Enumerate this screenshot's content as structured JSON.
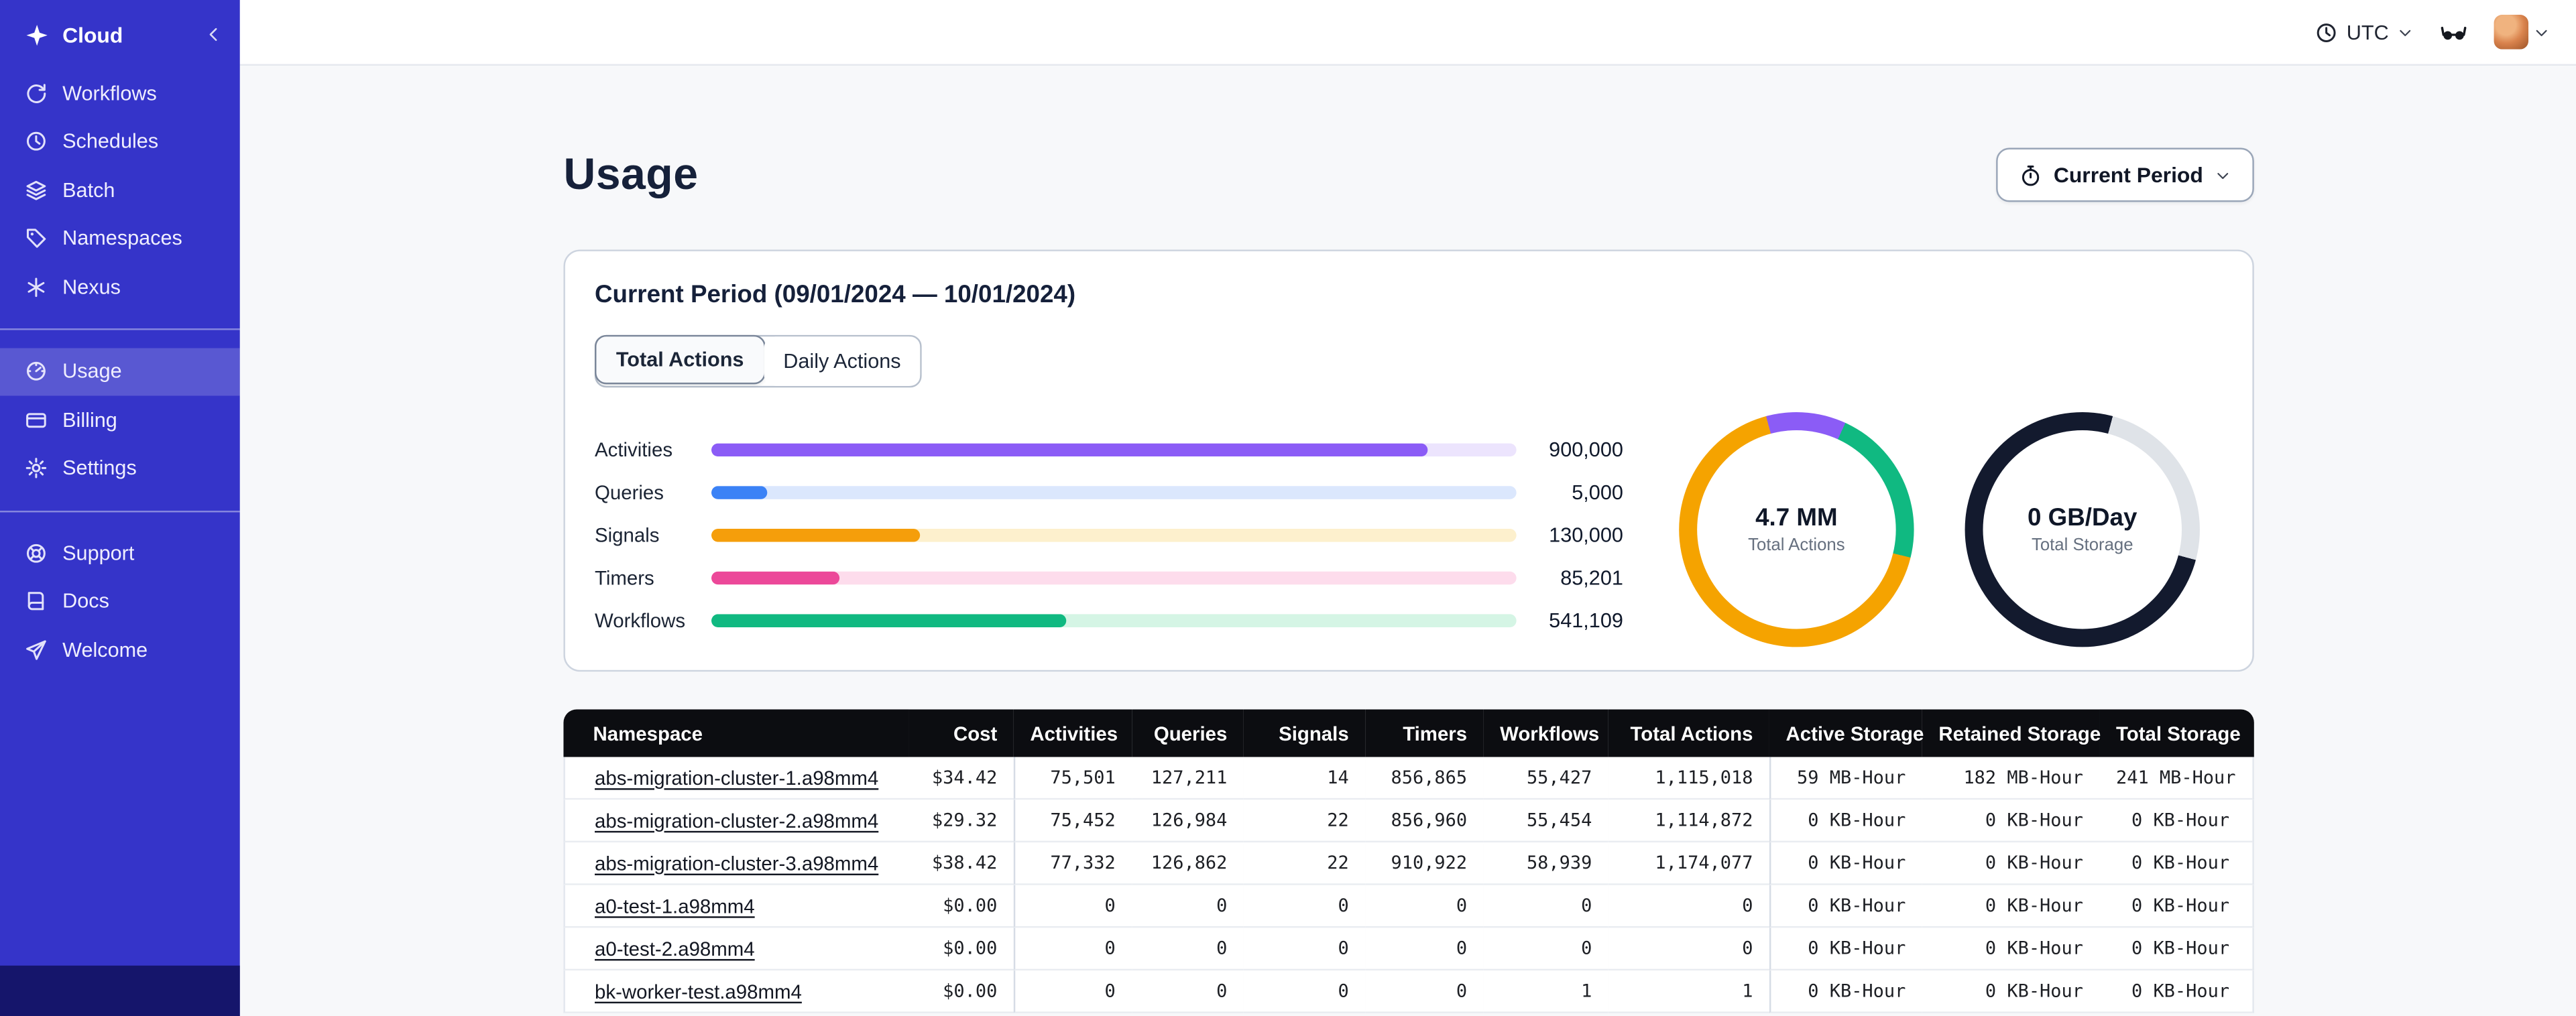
{
  "sidebar": {
    "brand_label": "Cloud",
    "nav_main": [
      {
        "label": "Workflows",
        "icon": "workflows-icon"
      },
      {
        "label": "Schedules",
        "icon": "schedules-icon"
      },
      {
        "label": "Batch",
        "icon": "batch-icon"
      },
      {
        "label": "Namespaces",
        "icon": "namespaces-icon"
      },
      {
        "label": "Nexus",
        "icon": "nexus-icon"
      }
    ],
    "nav_account": [
      {
        "label": "Usage",
        "icon": "usage-icon",
        "active": true
      },
      {
        "label": "Billing",
        "icon": "billing-icon"
      },
      {
        "label": "Settings",
        "icon": "settings-icon"
      }
    ],
    "nav_help": [
      {
        "label": "Support",
        "icon": "support-icon"
      },
      {
        "label": "Docs",
        "icon": "docs-icon"
      },
      {
        "label": "Welcome",
        "icon": "welcome-icon"
      }
    ],
    "colors": {
      "background": "#3534c9",
      "footer": "#15156b",
      "active_item": "rgba(255,255,255,0.18)"
    }
  },
  "topbar": {
    "timezone": "UTC"
  },
  "page": {
    "title": "Usage",
    "period_selector": {
      "label": "Current Period"
    },
    "card": {
      "title": "Current Period (09/01/2024 — 10/01/2024)",
      "tabs": [
        {
          "label": "Total Actions",
          "active": true
        },
        {
          "label": "Daily Actions",
          "active": false
        }
      ]
    }
  },
  "chart_data": [
    {
      "type": "bar",
      "orientation": "horizontal",
      "categories": [
        "Activities",
        "Queries",
        "Signals",
        "Timers",
        "Workflows"
      ],
      "values": [
        900000,
        5000,
        130000,
        85201,
        541109
      ],
      "value_labels": [
        "900,000",
        "5,000",
        "130,000",
        "85,201",
        "541,109"
      ],
      "bar_percents": [
        89,
        7,
        26,
        16,
        44
      ],
      "colors": [
        "#8b5cf6",
        "#3b82f6",
        "#f59e0b",
        "#ec4899",
        "#10b981"
      ],
      "track_colors": [
        "#ece4fd",
        "#dbe7fd",
        "#fdf0cd",
        "#fddcec",
        "#d5f5e5"
      ],
      "title": "",
      "xlabel": "",
      "ylabel": "",
      "grid": false,
      "legend": false
    },
    {
      "type": "pie",
      "style": "donut",
      "center_value": "4.7 MM",
      "center_label": "Total Actions",
      "start_angle": -15,
      "segments": [
        {
          "name": "purple-segment",
          "percent": 11,
          "color": "#8b5cf6"
        },
        {
          "name": "green-segment",
          "percent": 22,
          "color": "#10b981"
        },
        {
          "name": "orange-segment",
          "percent": 67,
          "color": "#f5a300"
        }
      ]
    },
    {
      "type": "pie",
      "style": "donut",
      "center_value": "0 GB/Day",
      "center_label": "Total Storage",
      "start_angle": 15,
      "segments": [
        {
          "name": "gray-segment",
          "percent": 25,
          "color": "#dfe3e8"
        },
        {
          "name": "dark-segment",
          "percent": 75,
          "color": "#131a2e"
        }
      ]
    }
  ],
  "table": {
    "columns": [
      "Namespace",
      "Cost",
      "Activities",
      "Queries",
      "Signals",
      "Timers",
      "Workflows",
      "Total Actions",
      "Active Storage",
      "Retained Storage",
      "Total Storage"
    ],
    "rows": [
      [
        "abs-migration-cluster-1.a98mm4",
        "$34.42",
        "75,501",
        "127,211",
        "14",
        "856,865",
        "55,427",
        "1,115,018",
        "59 MB-Hour",
        "182 MB-Hour",
        "241 MB-Hour"
      ],
      [
        "abs-migration-cluster-2.a98mm4",
        "$29.32",
        "75,452",
        "126,984",
        "22",
        "856,960",
        "55,454",
        "1,114,872",
        "0 KB-Hour",
        "0 KB-Hour",
        "0 KB-Hour"
      ],
      [
        "abs-migration-cluster-3.a98mm4",
        "$38.42",
        "77,332",
        "126,862",
        "22",
        "910,922",
        "58,939",
        "1,174,077",
        "0 KB-Hour",
        "0 KB-Hour",
        "0 KB-Hour"
      ],
      [
        "a0-test-1.a98mm4",
        "$0.00",
        "0",
        "0",
        "0",
        "0",
        "0",
        "0",
        "0 KB-Hour",
        "0 KB-Hour",
        "0 KB-Hour"
      ],
      [
        "a0-test-2.a98mm4",
        "$0.00",
        "0",
        "0",
        "0",
        "0",
        "0",
        "0",
        "0 KB-Hour",
        "0 KB-Hour",
        "0 KB-Hour"
      ],
      [
        "bk-worker-test.a98mm4",
        "$0.00",
        "0",
        "0",
        "0",
        "0",
        "1",
        "1",
        "0 KB-Hour",
        "0 KB-Hour",
        "0 KB-Hour"
      ]
    ]
  }
}
